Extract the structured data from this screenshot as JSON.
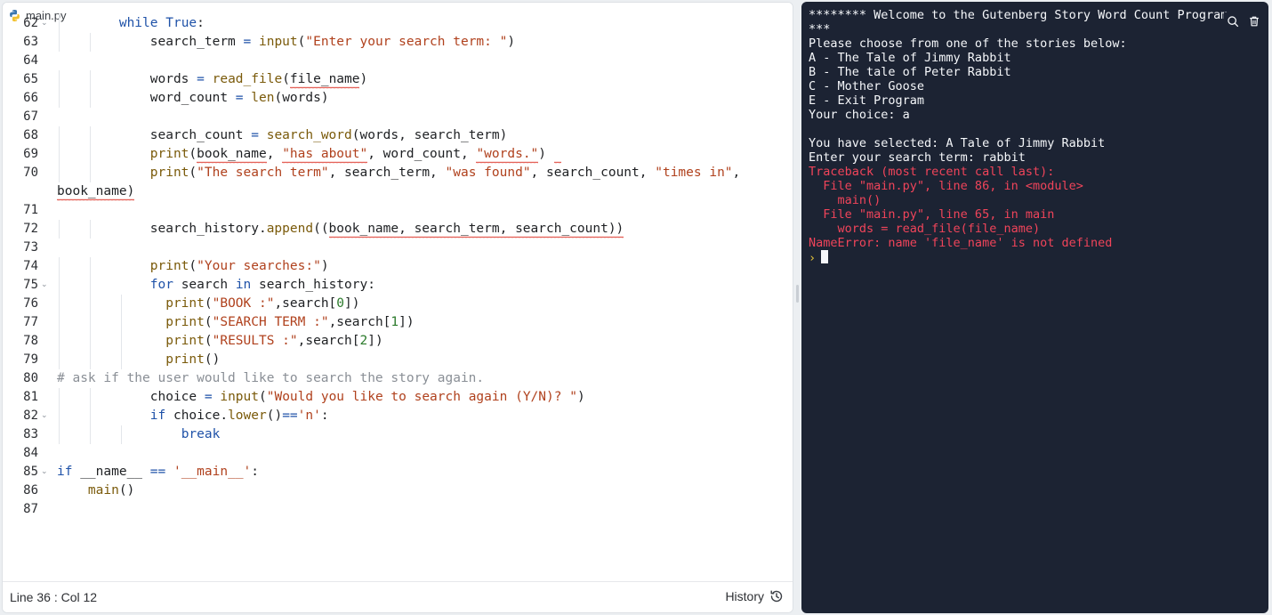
{
  "editor": {
    "file_tab": "main.py",
    "status_position": "Line 36 : Col 12",
    "history_label": "History",
    "lines": [
      {
        "n": "62",
        "text": "        while True:",
        "fold": true
      },
      {
        "n": "63",
        "text": "            search_term = input(\"Enter your search term: \")"
      },
      {
        "n": "64",
        "text": ""
      },
      {
        "n": "65",
        "text": "            words = read_file(file_name)"
      },
      {
        "n": "66",
        "text": "            word_count = len(words)"
      },
      {
        "n": "67",
        "text": ""
      },
      {
        "n": "68",
        "text": "            search_count = search_word(words, search_term)"
      },
      {
        "n": "69",
        "text": "            print(book_name, \"has about\", word_count, \"words.\")"
      },
      {
        "n": "70",
        "text": "            print(\"The search term\", search_term, \"was found\", search_count, \"times in\","
      },
      {
        "n": "",
        "text": "book_name)"
      },
      {
        "n": "71",
        "text": ""
      },
      {
        "n": "72",
        "text": "            search_history.append((book_name, search_term, search_count))"
      },
      {
        "n": "73",
        "text": ""
      },
      {
        "n": "74",
        "text": "            print(\"Your searches:\")"
      },
      {
        "n": "75",
        "text": "            for search in search_history:",
        "fold": true
      },
      {
        "n": "76",
        "text": "              print(\"BOOK :\",search[0])"
      },
      {
        "n": "77",
        "text": "              print(\"SEARCH TERM :\",search[1])"
      },
      {
        "n": "78",
        "text": "              print(\"RESULTS :\",search[2])"
      },
      {
        "n": "79",
        "text": "              print()"
      },
      {
        "n": "80",
        "text": "# ask if the user would like to search the story again."
      },
      {
        "n": "81",
        "text": "            choice = input(\"Would you like to search again (Y/N)? \")"
      },
      {
        "n": "82",
        "text": "            if choice.lower()=='n':",
        "fold": true
      },
      {
        "n": "83",
        "text": "                break"
      },
      {
        "n": "84",
        "text": ""
      },
      {
        "n": "85",
        "text": "if __name__ == '__main__':",
        "fold": true
      },
      {
        "n": "86",
        "text": "    main()"
      },
      {
        "n": "87",
        "text": ""
      }
    ]
  },
  "console": {
    "search_icon": "search-icon",
    "clear_icon": "trash-icon",
    "lines": [
      {
        "text": "******** Welcome to the Gutenberg Story Word Count Program ",
        "color": "white"
      },
      {
        "text": "***",
        "color": "white"
      },
      {
        "text": "Please choose from one of the stories below:",
        "color": "white"
      },
      {
        "text": "A - The Tale of Jimmy Rabbit",
        "color": "white"
      },
      {
        "text": "B - The tale of Peter Rabbit",
        "color": "white"
      },
      {
        "text": "C - Mother Goose",
        "color": "white"
      },
      {
        "text": "E - Exit Program",
        "color": "white"
      },
      {
        "text": "Your choice: a",
        "color": "white"
      },
      {
        "text": "",
        "color": "white"
      },
      {
        "text": "You have selected: A Tale of Jimmy Rabbit",
        "color": "white"
      },
      {
        "text": "Enter your search term: rabbit",
        "color": "white"
      },
      {
        "text": "Traceback (most recent call last):",
        "color": "red"
      },
      {
        "text": "  File \"main.py\", line 86, in <module>",
        "color": "red"
      },
      {
        "text": "    main()",
        "color": "red"
      },
      {
        "text": "  File \"main.py\", line 65, in main",
        "color": "red"
      },
      {
        "text": "    words = read_file(file_name)",
        "color": "red"
      },
      {
        "text": "NameError: name 'file_name' is not defined",
        "color": "red"
      }
    ],
    "prompt": "›",
    "colors": {
      "background": "#1c2333",
      "text": "#f5f7fa",
      "error": "#f0445a",
      "prompt": "#e8c53a"
    }
  }
}
